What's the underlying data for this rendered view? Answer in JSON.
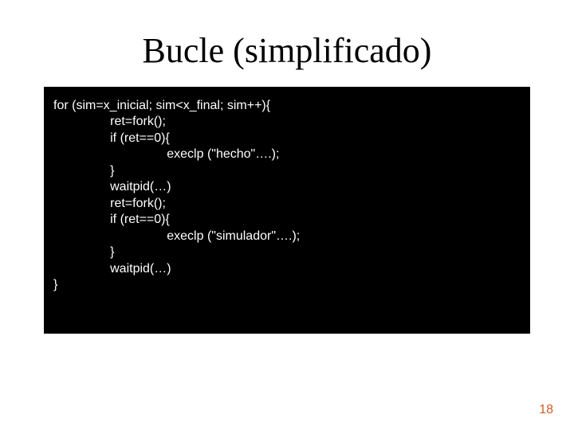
{
  "title": "Bucle (simplificado)",
  "code": {
    "l0": "for (sim=x_inicial; sim<x_final; sim++){",
    "l1": "                ret=fork();",
    "l2": "                if (ret==0){",
    "l3": "                                execlp (\"hecho\"….);",
    "l4": "                }",
    "l5": "                waitpid(…)",
    "l6": "                ret=fork();",
    "l7": "                if (ret==0){",
    "l8": "                                execlp (\"simulador\"….);",
    "l9": "                }",
    "l10": "                waitpid(…)",
    "l11": "}"
  },
  "page_number": "18"
}
